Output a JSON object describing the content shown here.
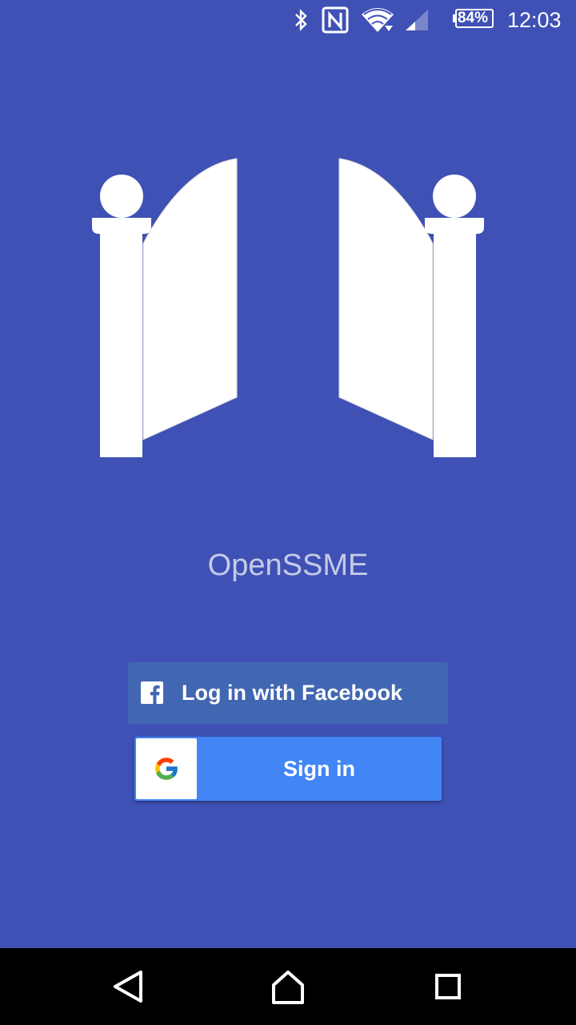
{
  "status_bar": {
    "battery_level": "84%",
    "time": "12:03",
    "icons": [
      "bluetooth-icon",
      "nfc-icon",
      "wifi-icon",
      "cell-signal-icon",
      "battery-icon"
    ]
  },
  "app": {
    "name": "OpenSSME",
    "logo_icon": "gate-icon"
  },
  "login": {
    "facebook_label": "Log in with Facebook",
    "google_label": "Sign in"
  },
  "nav_bar": {
    "icons": [
      "back-icon",
      "home-icon",
      "recents-icon"
    ]
  },
  "colors": {
    "background": "#3f51b5",
    "facebook": "#4267b2",
    "google": "#4285f4",
    "app_name_text": "#c5cae9"
  }
}
